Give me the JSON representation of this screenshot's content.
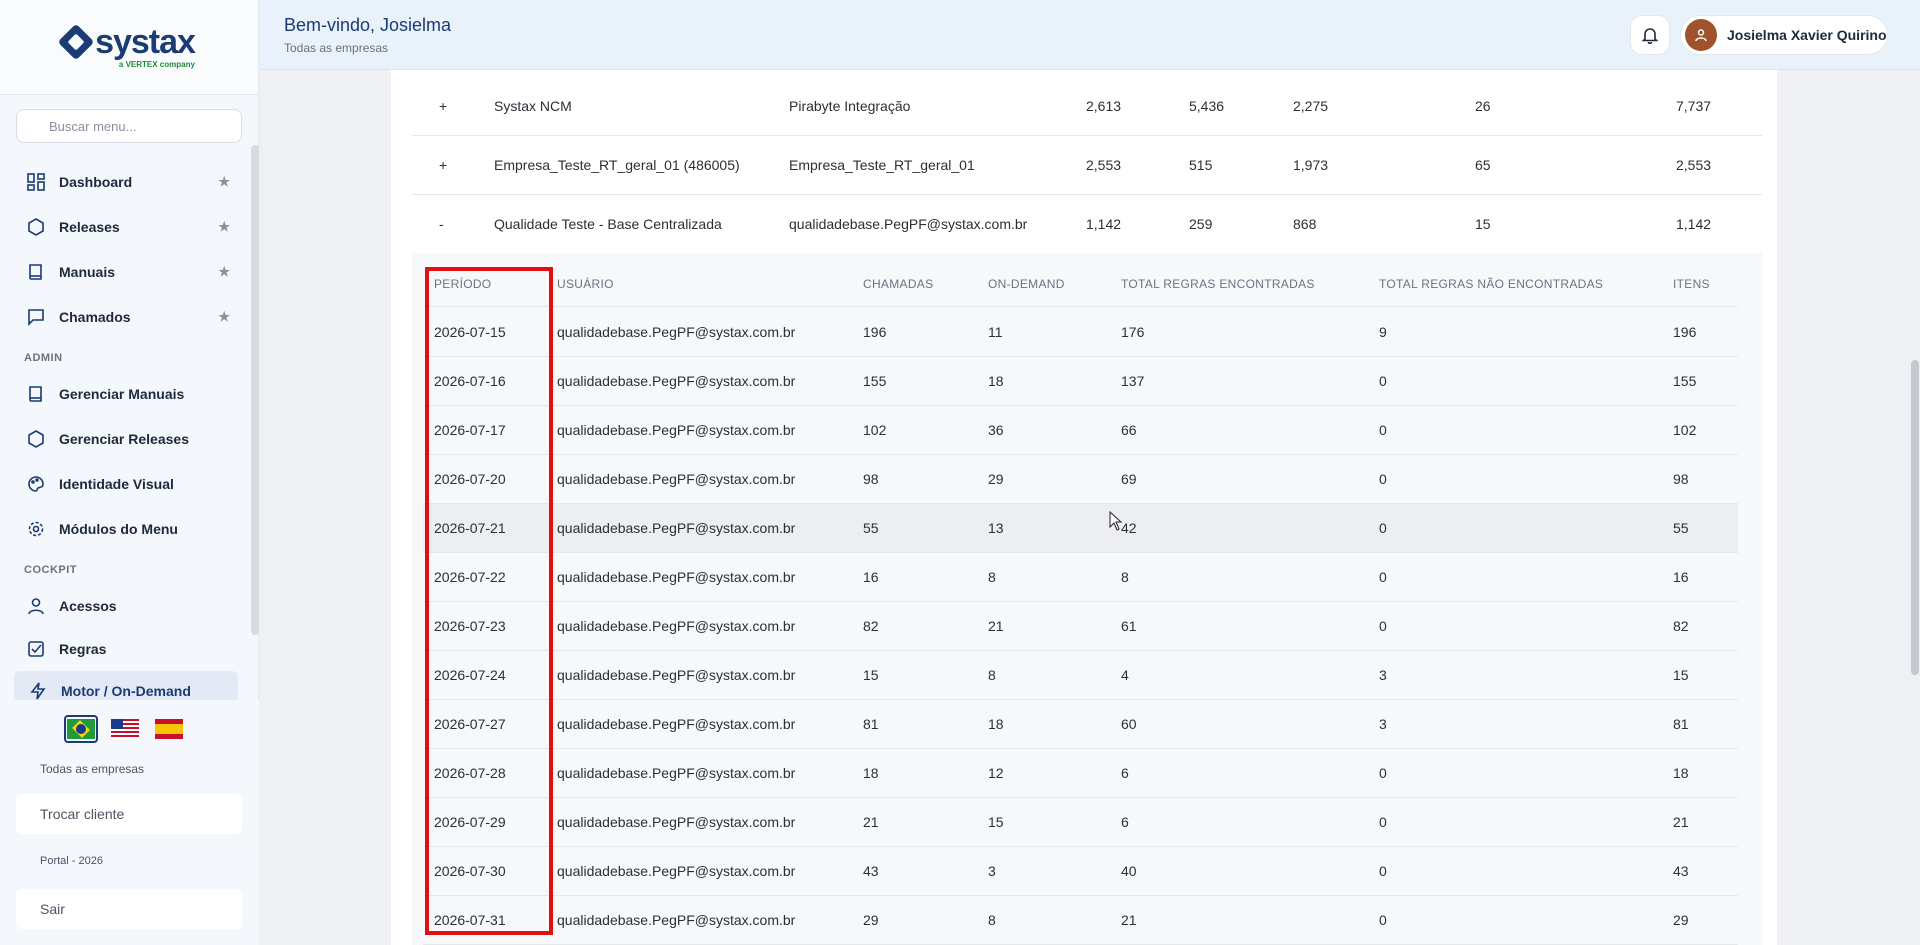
{
  "brand": {
    "logo_text": "systax",
    "logo_sub": "a VERTEX company"
  },
  "sidebar": {
    "search_placeholder": "Buscar menu...",
    "items": [
      {
        "label": "Dashboard",
        "icon": "dashboard-icon",
        "starred": true
      },
      {
        "label": "Releases",
        "icon": "hexagon-icon",
        "starred": true
      },
      {
        "label": "Manuais",
        "icon": "book-icon",
        "starred": true
      },
      {
        "label": "Chamados",
        "icon": "chat-icon",
        "starred": true
      }
    ],
    "section_admin": "ADMIN",
    "admin_items": [
      {
        "label": "Gerenciar Manuais",
        "icon": "book-icon"
      },
      {
        "label": "Gerenciar Releases",
        "icon": "hexagon-icon"
      },
      {
        "label": "Identidade Visual",
        "icon": "palette-icon"
      },
      {
        "label": "Módulos do Menu",
        "icon": "gear-icon"
      }
    ],
    "section_cockpit": "COCKPIT",
    "cockpit_items": [
      {
        "label": "Acessos",
        "icon": "user-icon"
      },
      {
        "label": "Regras",
        "icon": "checkbox-icon"
      },
      {
        "label": "Motor / On-Demand",
        "icon": "bolt-icon",
        "active": true
      }
    ],
    "bottom": {
      "languages": [
        "pt-BR",
        "en-US",
        "es-ES"
      ],
      "selected_language": "pt-BR",
      "company_caption": "Todas as empresas",
      "switch_client": "Trocar cliente",
      "portal_caption": "Portal - 2026",
      "logout": "Sair"
    }
  },
  "header": {
    "welcome": "Bem-vindo, Josielma",
    "subtitle": "Todas as empresas",
    "user_name": "Josielma Xavier Quirino"
  },
  "outer_rows": [
    {
      "toggle": "+",
      "name": "Systax NCM",
      "user": "Pirabyte Integração",
      "c1": "2,613",
      "c2": "5,436",
      "c3": "2,275",
      "c4": "26",
      "c5": "7,737"
    },
    {
      "toggle": "+",
      "name": "Empresa_Teste_RT_geral_01 (486005)",
      "user": "Empresa_Teste_RT_geral_01",
      "c1": "2,553",
      "c2": "515",
      "c3": "1,973",
      "c4": "65",
      "c5": "2,553"
    },
    {
      "toggle": "-",
      "name": "Qualidade Teste - Base Centralizada",
      "user": "qualidadebase.PegPF@systax.com.br",
      "c1": "1,142",
      "c2": "259",
      "c3": "868",
      "c4": "15",
      "c5": "1,142"
    }
  ],
  "detail_headers": {
    "periodo": "PERÍODO",
    "usuario": "USUÁRIO",
    "chamadas": "CHAMADAS",
    "on_demand": "ON-DEMAND",
    "encontradas": "TOTAL REGRAS ENCONTRADAS",
    "nao_encontradas": "TOTAL REGRAS NÃO ENCONTRADAS",
    "itens": "ITENS"
  },
  "detail_rows": [
    {
      "periodo": "2026-07-15",
      "usuario": "qualidadebase.PegPF@systax.com.br",
      "chamadas": "196",
      "on_demand": "11",
      "encontradas": "176",
      "nao_encontradas": "9",
      "itens": "196"
    },
    {
      "periodo": "2026-07-16",
      "usuario": "qualidadebase.PegPF@systax.com.br",
      "chamadas": "155",
      "on_demand": "18",
      "encontradas": "137",
      "nao_encontradas": "0",
      "itens": "155"
    },
    {
      "periodo": "2026-07-17",
      "usuario": "qualidadebase.PegPF@systax.com.br",
      "chamadas": "102",
      "on_demand": "36",
      "encontradas": "66",
      "nao_encontradas": "0",
      "itens": "102"
    },
    {
      "periodo": "2026-07-20",
      "usuario": "qualidadebase.PegPF@systax.com.br",
      "chamadas": "98",
      "on_demand": "29",
      "encontradas": "69",
      "nao_encontradas": "0",
      "itens": "98"
    },
    {
      "periodo": "2026-07-21",
      "usuario": "qualidadebase.PegPF@systax.com.br",
      "chamadas": "55",
      "on_demand": "13",
      "encontradas": "42",
      "nao_encontradas": "0",
      "itens": "55"
    },
    {
      "periodo": "2026-07-22",
      "usuario": "qualidadebase.PegPF@systax.com.br",
      "chamadas": "16",
      "on_demand": "8",
      "encontradas": "8",
      "nao_encontradas": "0",
      "itens": "16"
    },
    {
      "periodo": "2026-07-23",
      "usuario": "qualidadebase.PegPF@systax.com.br",
      "chamadas": "82",
      "on_demand": "21",
      "encontradas": "61",
      "nao_encontradas": "0",
      "itens": "82"
    },
    {
      "periodo": "2026-07-24",
      "usuario": "qualidadebase.PegPF@systax.com.br",
      "chamadas": "15",
      "on_demand": "8",
      "encontradas": "4",
      "nao_encontradas": "3",
      "itens": "15"
    },
    {
      "periodo": "2026-07-27",
      "usuario": "qualidadebase.PegPF@systax.com.br",
      "chamadas": "81",
      "on_demand": "18",
      "encontradas": "60",
      "nao_encontradas": "3",
      "itens": "81"
    },
    {
      "periodo": "2026-07-28",
      "usuario": "qualidadebase.PegPF@systax.com.br",
      "chamadas": "18",
      "on_demand": "12",
      "encontradas": "6",
      "nao_encontradas": "0",
      "itens": "18"
    },
    {
      "periodo": "2026-07-29",
      "usuario": "qualidadebase.PegPF@systax.com.br",
      "chamadas": "21",
      "on_demand": "15",
      "encontradas": "6",
      "nao_encontradas": "0",
      "itens": "21"
    },
    {
      "periodo": "2026-07-30",
      "usuario": "qualidadebase.PegPF@systax.com.br",
      "chamadas": "43",
      "on_demand": "3",
      "encontradas": "40",
      "nao_encontradas": "0",
      "itens": "43"
    },
    {
      "periodo": "2026-07-31",
      "usuario": "qualidadebase.PegPF@systax.com.br",
      "chamadas": "29",
      "on_demand": "8",
      "encontradas": "21",
      "nao_encontradas": "0",
      "itens": "29"
    }
  ],
  "colors": {
    "accent": "#1a3b73",
    "highlight": "#e01010",
    "header_bg": "#e9f1fb"
  }
}
